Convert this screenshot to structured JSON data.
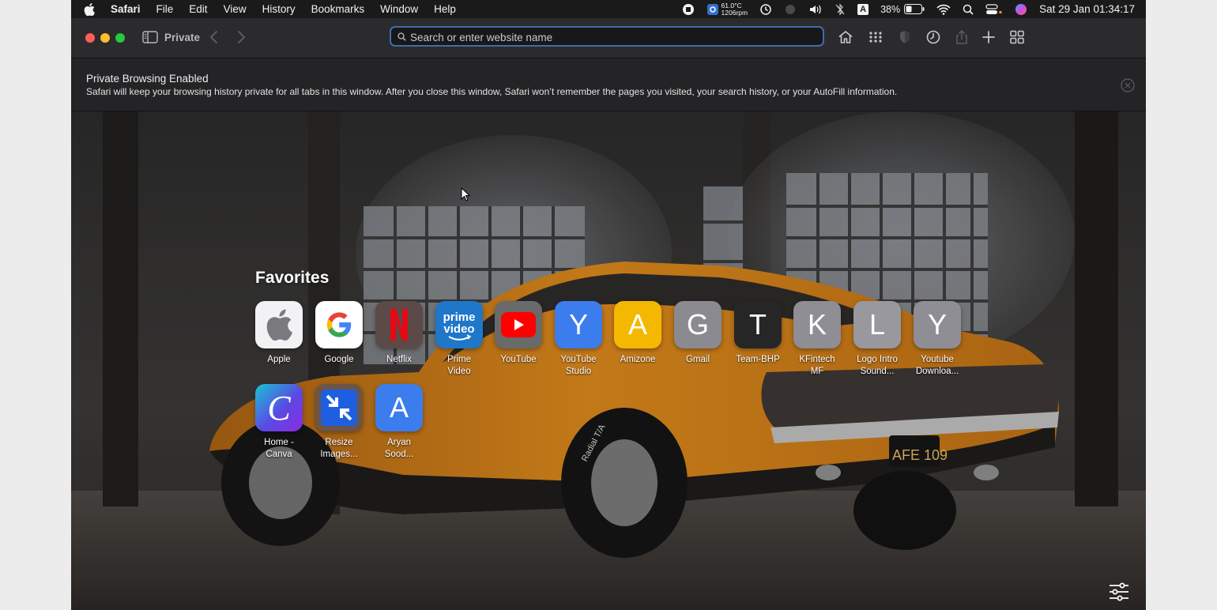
{
  "menubar": {
    "items": [
      "Safari",
      "File",
      "Edit",
      "View",
      "History",
      "Bookmarks",
      "Window",
      "Help"
    ],
    "temp_line1": "61.0°C",
    "temp_line2": "1206rpm",
    "input_letter": "A",
    "battery": "38%",
    "clock": "Sat 29 Jan  01:34:17"
  },
  "toolbar": {
    "private_label": "Private",
    "search_placeholder": "Search or enter website name"
  },
  "banner": {
    "title": "Private Browsing Enabled",
    "text": "Safari will keep your browsing history private for all tabs in this window. After you close this window, Safari won’t remember the pages you visited, your search history, or your AutoFill information."
  },
  "favorites": {
    "title": "Favorites",
    "items": [
      {
        "name": "Apple",
        "label": "Apple",
        "glyph": "",
        "color": "#ffffff"
      },
      {
        "name": "Google",
        "label": "Google",
        "glyph": "",
        "color": "#ffffff"
      },
      {
        "name": "Netflix",
        "label": "Netflix",
        "glyph": "N",
        "color": "#5c4a48"
      },
      {
        "name": "Prime Video",
        "label": "Prime\nVideo",
        "glyph": "",
        "color": "#1f77c9"
      },
      {
        "name": "YouTube",
        "label": "YouTube",
        "glyph": "",
        "color": "#6a6a6a"
      },
      {
        "name": "YouTube Studio",
        "label": "YouTube\nStudio",
        "glyph": "Y",
        "color": "#3b7ded"
      },
      {
        "name": "Amizone",
        "label": "Amizone",
        "glyph": "A",
        "color": "#f5b800"
      },
      {
        "name": "Gmail",
        "label": "Gmail",
        "glyph": "G",
        "color": "#8a8a90"
      },
      {
        "name": "Team-BHP",
        "label": "Team-BHP",
        "glyph": "T",
        "color": "#262626"
      },
      {
        "name": "KFintech MF",
        "label": "KFintech\nMF",
        "glyph": "K",
        "color": "#8e8e94"
      },
      {
        "name": "Logo Intro Sound",
        "label": "Logo Intro\nSound...",
        "glyph": "L",
        "color": "#98989e"
      },
      {
        "name": "Youtube Downloader",
        "label": "Youtube\nDownloa...",
        "glyph": "Y",
        "color": "#8e8e94"
      },
      {
        "name": "Home - Canva",
        "label": "Home -\nCanva",
        "glyph": "C",
        "color": "#7d3fe0"
      },
      {
        "name": "Resize Images",
        "label": "Resize\nImages...",
        "glyph": "",
        "color": "#1d5fe0"
      },
      {
        "name": "Aryan Sood",
        "label": "Aryan\nSood...",
        "glyph": "A",
        "color": "#3b7ded"
      }
    ]
  },
  "wallpaper": {
    "license_plate": "AFE 109",
    "tyre_text": "Radial T/A"
  }
}
